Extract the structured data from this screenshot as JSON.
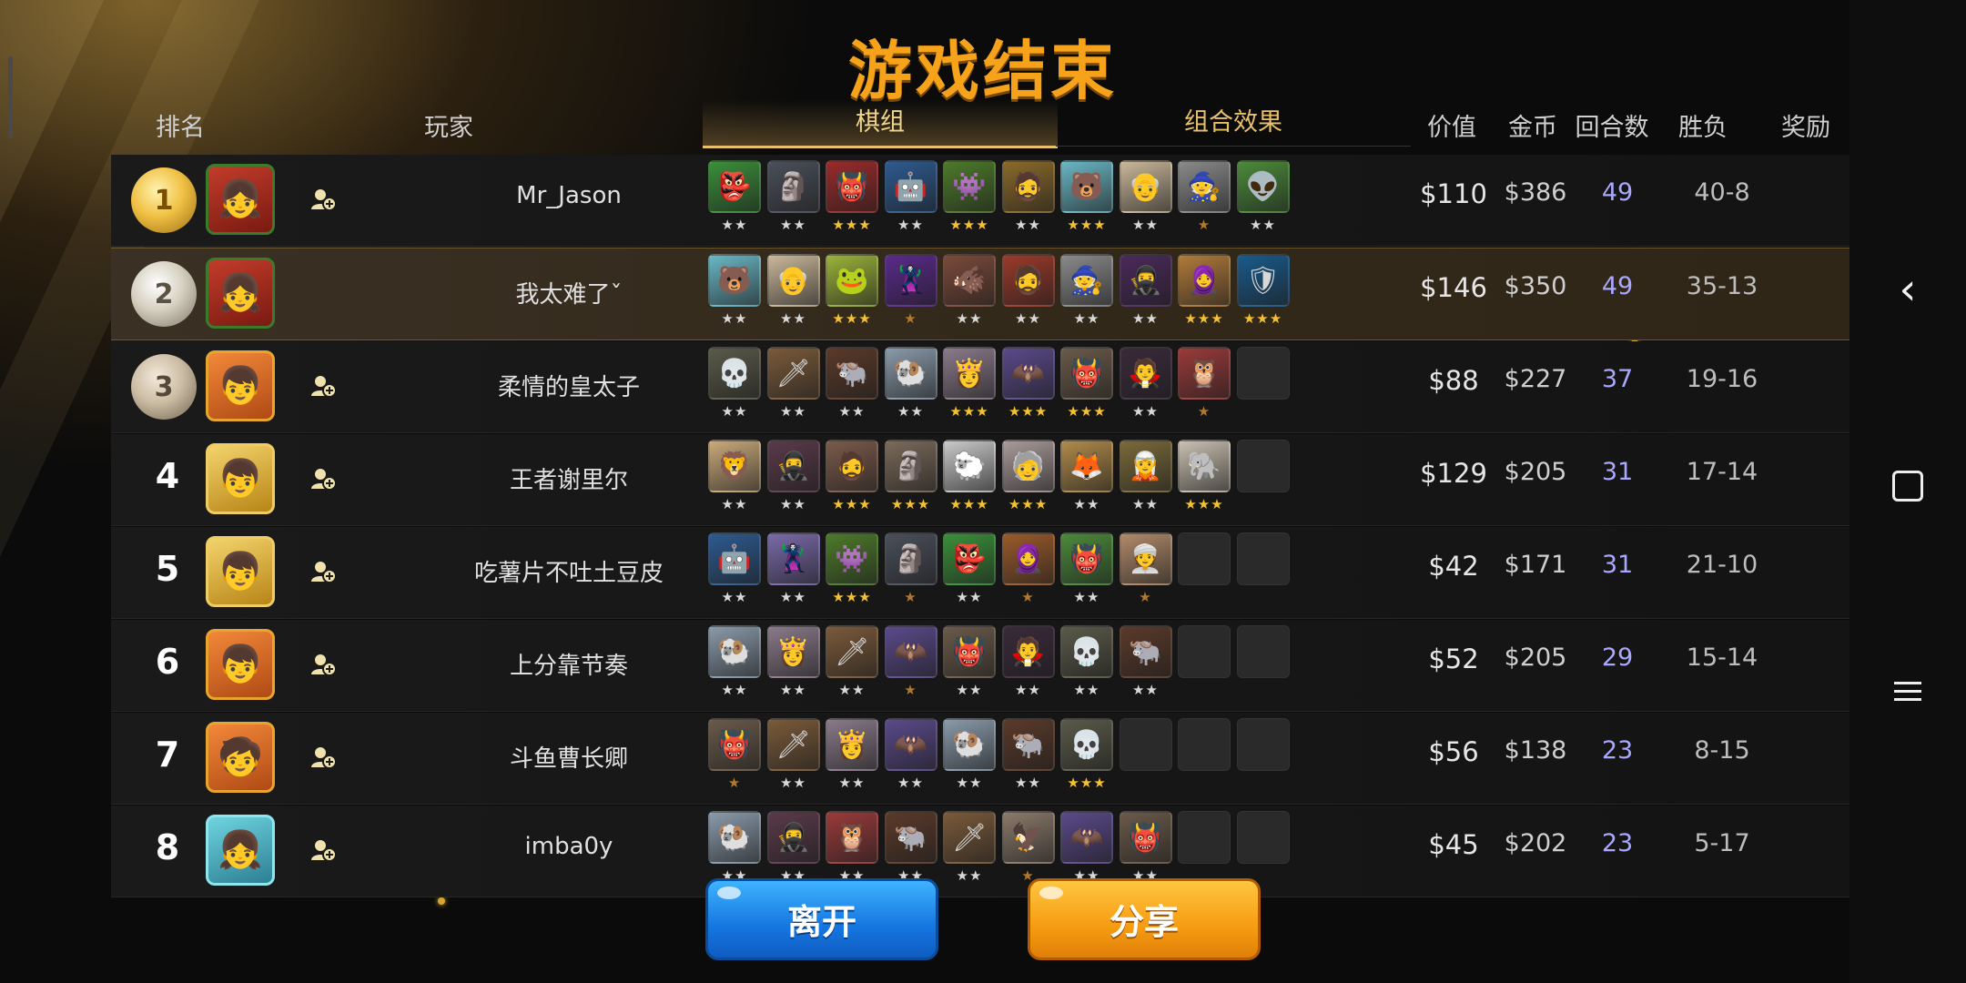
{
  "title": "游戏结束",
  "headers": {
    "rank": "排名",
    "player": "玩家",
    "tab_lineup": "棋组",
    "tab_synergy": "组合效果",
    "value": "价值",
    "gold": "金币",
    "rounds": "回合数",
    "win_loss": "胜负",
    "reward": "奖励"
  },
  "players": [
    {
      "rank": "1",
      "medal": "gold",
      "avatar": "red",
      "avatar_icon": "👧",
      "show_add": true,
      "name": "Mr_Jason",
      "value": "$110",
      "gold": "$386",
      "rounds": "49",
      "wl": "40-8",
      "highlight": false,
      "pieces": [
        {
          "icon": "👺",
          "color": "#3b8f3a",
          "stars": 2
        },
        {
          "icon": "🗿",
          "color": "#4a4f5a",
          "stars": 2
        },
        {
          "icon": "👹",
          "color": "#9a2a2a",
          "stars": 3
        },
        {
          "icon": "🤖",
          "color": "#2e5a8f",
          "stars": 2
        },
        {
          "icon": "👾",
          "color": "#4d7a2a",
          "stars": 3
        },
        {
          "icon": "🧔",
          "color": "#8a6a2a",
          "stars": 2
        },
        {
          "icon": "🐻",
          "color": "#6ab6c4",
          "stars": 3
        },
        {
          "icon": "👴",
          "color": "#c9b79a",
          "stars": 2
        },
        {
          "icon": "🧙",
          "color": "#8a8a8a",
          "stars": 1
        },
        {
          "icon": "👽",
          "color": "#4b8a3a",
          "stars": 2
        }
      ]
    },
    {
      "rank": "2",
      "medal": "silver",
      "avatar": "red",
      "avatar_icon": "👧",
      "show_add": false,
      "name": "我太难了ˇ",
      "value": "$146",
      "gold": "$350",
      "rounds": "49",
      "wl": "35-13",
      "highlight": true,
      "pieces": [
        {
          "icon": "🐻",
          "color": "#6ab6c4",
          "stars": 2
        },
        {
          "icon": "👴",
          "color": "#c9b79a",
          "stars": 2
        },
        {
          "icon": "🐸",
          "color": "#9ab23a",
          "stars": 3
        },
        {
          "icon": "🦹",
          "color": "#5a2a8a",
          "stars": 1
        },
        {
          "icon": "🐗",
          "color": "#7a4a3a",
          "stars": 2
        },
        {
          "icon": "🧔",
          "color": "#9a3a2a",
          "stars": 2
        },
        {
          "icon": "🧙",
          "color": "#8a8a8a",
          "stars": 2
        },
        {
          "icon": "🥷",
          "color": "#4a2a5a",
          "stars": 2
        },
        {
          "icon": "🧕",
          "color": "#b07a3a",
          "stars": 3
        },
        {
          "icon": "🛡",
          "color": "#1a5a8a",
          "stars": 3
        }
      ]
    },
    {
      "rank": "3",
      "medal": "bronze",
      "avatar": "orange",
      "avatar_icon": "👦",
      "show_add": true,
      "name": "柔情的皇太子",
      "value": "$88",
      "gold": "$227",
      "rounds": "37",
      "wl": "19-16",
      "highlight": false,
      "pieces": [
        {
          "icon": "💀",
          "color": "#5a5a4a",
          "stars": 2
        },
        {
          "icon": "🗡",
          "color": "#7a5a3a",
          "stars": 2
        },
        {
          "icon": "🐃",
          "color": "#5a3a2a",
          "stars": 2
        },
        {
          "icon": "🐏",
          "color": "#8a9aaa",
          "stars": 2
        },
        {
          "icon": "👸",
          "color": "#8a7a8a",
          "stars": 3
        },
        {
          "icon": "🦇",
          "color": "#5a4a8a",
          "stars": 3
        },
        {
          "icon": "👹",
          "color": "#6a5a4a",
          "stars": 3
        },
        {
          "icon": "🧛",
          "color": "#3a2a3a",
          "stars": 2
        },
        {
          "icon": "🦉",
          "color": "#9a3a3a",
          "stars": 1
        },
        {
          "icon": "",
          "color": "",
          "stars": 0
        }
      ]
    },
    {
      "rank": "4",
      "medal": "",
      "avatar": "gold",
      "avatar_icon": "👦",
      "show_add": true,
      "name": "王者谢里尔",
      "value": "$129",
      "gold": "$205",
      "rounds": "31",
      "wl": "17-14",
      "highlight": false,
      "pieces": [
        {
          "icon": "🦁",
          "color": "#c9a97a",
          "stars": 2
        },
        {
          "icon": "🥷",
          "color": "#5a3a4a",
          "stars": 2
        },
        {
          "icon": "🧔",
          "color": "#7a5a4a",
          "stars": 3
        },
        {
          "icon": "🗿",
          "color": "#7a6a5a",
          "stars": 3
        },
        {
          "icon": "🐑",
          "color": "#c9c9c9",
          "stars": 3
        },
        {
          "icon": "🧓",
          "color": "#a99a9a",
          "stars": 3
        },
        {
          "icon": "🦊",
          "color": "#b08a4a",
          "stars": 2
        },
        {
          "icon": "🧝",
          "color": "#7a6a3a",
          "stars": 2
        },
        {
          "icon": "🐘",
          "color": "#c9c0b0",
          "stars": 3
        },
        {
          "icon": "",
          "color": "",
          "stars": 0
        }
      ]
    },
    {
      "rank": "5",
      "medal": "",
      "avatar": "gold",
      "avatar_icon": "👦",
      "show_add": true,
      "name": "吃薯片不吐土豆皮",
      "value": "$42",
      "gold": "$171",
      "rounds": "31",
      "wl": "21-10",
      "highlight": false,
      "pieces": [
        {
          "icon": "🤖",
          "color": "#2e5a8f",
          "stars": 2
        },
        {
          "icon": "🦹",
          "color": "#7a6aa9",
          "stars": 2
        },
        {
          "icon": "👾",
          "color": "#4d7a2a",
          "stars": 3
        },
        {
          "icon": "🗿",
          "color": "#4a4f5a",
          "stars": 1
        },
        {
          "icon": "👺",
          "color": "#3b8f3a",
          "stars": 2
        },
        {
          "icon": "🧕",
          "color": "#9a5a2a",
          "stars": 1
        },
        {
          "icon": "👹",
          "color": "#4b8a3a",
          "stars": 2
        },
        {
          "icon": "👳",
          "color": "#b08a6a",
          "stars": 1
        },
        {
          "icon": "",
          "color": "",
          "stars": 0
        },
        {
          "icon": "",
          "color": "",
          "stars": 0
        }
      ]
    },
    {
      "rank": "6",
      "medal": "",
      "avatar": "orange",
      "avatar_icon": "👦",
      "show_add": true,
      "name": "上分靠节奏",
      "value": "$52",
      "gold": "$205",
      "rounds": "29",
      "wl": "15-14",
      "highlight": false,
      "pieces": [
        {
          "icon": "🐏",
          "color": "#8a9aaa",
          "stars": 2
        },
        {
          "icon": "👸",
          "color": "#8a7a8a",
          "stars": 2
        },
        {
          "icon": "🗡",
          "color": "#7a5a3a",
          "stars": 2
        },
        {
          "icon": "🦇",
          "color": "#5a4a8a",
          "stars": 1
        },
        {
          "icon": "👹",
          "color": "#6a5a4a",
          "stars": 2
        },
        {
          "icon": "🧛",
          "color": "#3a2a3a",
          "stars": 2
        },
        {
          "icon": "💀",
          "color": "#5a5a4a",
          "stars": 2
        },
        {
          "icon": "🐃",
          "color": "#5a3a2a",
          "stars": 2
        },
        {
          "icon": "",
          "color": "",
          "stars": 0
        },
        {
          "icon": "",
          "color": "",
          "stars": 0
        }
      ]
    },
    {
      "rank": "7",
      "medal": "",
      "avatar": "orange",
      "avatar_icon": "🧒",
      "show_add": true,
      "name": "斗鱼曹长卿",
      "value": "$56",
      "gold": "$138",
      "rounds": "23",
      "wl": "8-15",
      "highlight": false,
      "pieces": [
        {
          "icon": "👹",
          "color": "#6a5a4a",
          "stars": 1
        },
        {
          "icon": "🗡",
          "color": "#7a5a3a",
          "stars": 2
        },
        {
          "icon": "👸",
          "color": "#8a7a8a",
          "stars": 2
        },
        {
          "icon": "🦇",
          "color": "#5a4a8a",
          "stars": 2
        },
        {
          "icon": "🐏",
          "color": "#8a9aaa",
          "stars": 2
        },
        {
          "icon": "🐃",
          "color": "#5a3a2a",
          "stars": 2
        },
        {
          "icon": "💀",
          "color": "#5a5a4a",
          "stars": 3
        },
        {
          "icon": "",
          "color": "",
          "stars": 0
        },
        {
          "icon": "",
          "color": "",
          "stars": 0
        },
        {
          "icon": "",
          "color": "",
          "stars": 0
        }
      ]
    },
    {
      "rank": "8",
      "medal": "",
      "avatar": "cyan",
      "avatar_icon": "👧",
      "show_add": true,
      "name": "imba0y",
      "value": "$45",
      "gold": "$202",
      "rounds": "23",
      "wl": "5-17",
      "highlight": false,
      "pieces": [
        {
          "icon": "🐏",
          "color": "#8a9aaa",
          "stars": 2
        },
        {
          "icon": "🥷",
          "color": "#5a3a4a",
          "stars": 2
        },
        {
          "icon": "🦉",
          "color": "#9a3a3a",
          "stars": 2
        },
        {
          "icon": "🐃",
          "color": "#5a3a2a",
          "stars": 2
        },
        {
          "icon": "🗡",
          "color": "#7a5a3a",
          "stars": 2
        },
        {
          "icon": "🦅",
          "color": "#8a7a6a",
          "stars": 1
        },
        {
          "icon": "🦇",
          "color": "#5a4a8a",
          "stars": 2
        },
        {
          "icon": "👹",
          "color": "#6a5a4a",
          "stars": 2
        },
        {
          "icon": "",
          "color": "",
          "stars": 0
        },
        {
          "icon": "",
          "color": "",
          "stars": 0
        }
      ]
    }
  ],
  "buttons": {
    "leave": "离开",
    "share": "分享"
  },
  "colors": {
    "title": "#f7a21b",
    "rounds_text": "#a9a8ff",
    "leave_button": "#1576e0",
    "share_button": "#f69c12",
    "highlight_row": "#33291b"
  },
  "icons": {
    "add_friend": "add-friend-icon",
    "nav_back": "back-icon",
    "nav_home": "home-icon",
    "nav_recent": "recent-apps-icon"
  }
}
